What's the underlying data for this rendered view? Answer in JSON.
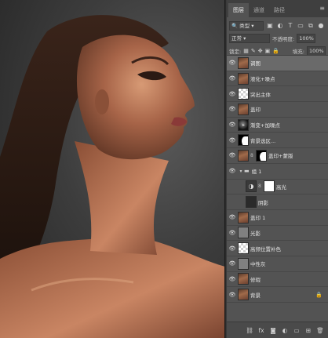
{
  "panel": {
    "tabs": [
      {
        "label": "图层",
        "active": true
      },
      {
        "label": "通道",
        "active": false
      },
      {
        "label": "路径",
        "active": false
      }
    ],
    "filter": {
      "label": "类型",
      "icons": [
        "image-filter-icon",
        "adjustment-filter-icon",
        "type-filter-icon",
        "shape-filter-icon",
        "smart-object-filter-icon"
      ]
    },
    "blend_mode": "正常",
    "opacity_label": "不透明度:",
    "opacity_value": "100%",
    "lock_label": "锁定:",
    "fill_label": "填充:",
    "fill_value": "100%",
    "layers": [
      {
        "name": "调图",
        "thumb": "face",
        "visible": true,
        "selected": true
      },
      {
        "name": "液化+噪点",
        "thumb": "face",
        "visible": true
      },
      {
        "name": "突出主体",
        "thumb": "checker",
        "visible": true
      },
      {
        "name": "盖印",
        "thumb": "face",
        "visible": true
      },
      {
        "name": "渐变+加噪点",
        "thumb": "grad",
        "visible": true,
        "effect": true
      },
      {
        "name": "背景选区...",
        "thumb": "silh",
        "visible": true
      },
      {
        "name": "盖印+蒙版",
        "thumb": "face",
        "mask": "silh",
        "visible": true
      },
      {
        "name": "组 1",
        "group": true,
        "visible": true
      },
      {
        "name": "高光",
        "thumb": "adj",
        "mask": "mask-w",
        "visible": false,
        "indented": true
      },
      {
        "name": "阴影",
        "thumb": "dark",
        "visible": false,
        "indented": true
      },
      {
        "name": "盖印 1",
        "thumb": "face",
        "visible": true
      },
      {
        "name": "光影",
        "thumb": "gray",
        "visible": true
      },
      {
        "name": "高频位置补色",
        "thumb": "checker",
        "visible": true
      },
      {
        "name": "中性灰",
        "thumb": "gray",
        "visible": true
      },
      {
        "name": "修瑕",
        "thumb": "face",
        "visible": true
      },
      {
        "name": "背景",
        "thumb": "face",
        "visible": true,
        "locked": true
      }
    ],
    "bottom_icons": [
      "link-layers-icon",
      "fx-icon",
      "add-mask-icon",
      "adjustment-layer-icon",
      "new-group-icon",
      "new-layer-icon",
      "delete-layer-icon"
    ],
    "bottom_glyphs": [
      "⛓",
      "fx",
      "◙",
      "◐",
      "▭",
      "⊞",
      "🗑"
    ]
  }
}
